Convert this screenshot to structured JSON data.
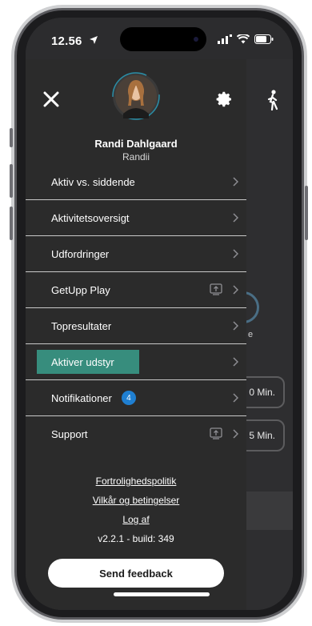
{
  "status_bar": {
    "time": "12.56",
    "icons": [
      "location-arrow-icon",
      "signal-icon",
      "wifi-icon",
      "battery-icon"
    ]
  },
  "drawer": {
    "user": {
      "name": "Randi Dahlgaard",
      "handle": "Randii"
    },
    "icons": {
      "close": "close-icon",
      "settings": "gear-icon",
      "avatar": "user-avatar"
    },
    "menu": [
      {
        "label": "Aktiv vs. siddende"
      },
      {
        "label": "Aktivitetsoversigt"
      },
      {
        "label": "Udfordringer"
      },
      {
        "label": "GetUpp Play",
        "external": true
      },
      {
        "label": "Topresultater"
      },
      {
        "label": "Aktiver udstyr",
        "highlighted": true
      },
      {
        "label": "Notifikationer",
        "badge": "4"
      },
      {
        "label": "Support",
        "external": true
      }
    ],
    "links": {
      "privacy": "Fortrolighedspolitik",
      "terms": "Vilkår og betingelser",
      "logout": "Log af"
    },
    "version": "v2.2.1 - build: 349",
    "feedback_button": "Send feedback"
  },
  "background_app": {
    "letter": "e",
    "pill_1": "0 Min.",
    "pill_2": "5 Min."
  },
  "colors": {
    "drawer_bg": "#2b2b2b",
    "highlight": "#3a9f8c",
    "badge": "#1f7fd1"
  }
}
